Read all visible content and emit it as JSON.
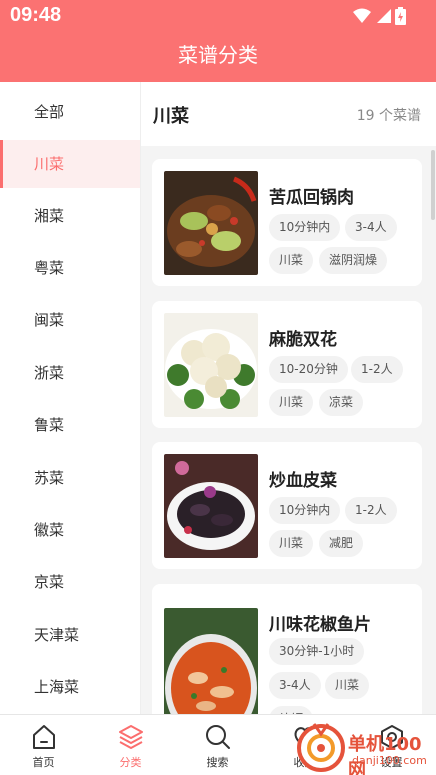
{
  "status_bar": {
    "time": "09:48"
  },
  "header": {
    "title": "菜谱分类"
  },
  "sidebar": {
    "items": [
      {
        "label": "全部"
      },
      {
        "label": "川菜",
        "active": true
      },
      {
        "label": "湘菜"
      },
      {
        "label": "粤菜"
      },
      {
        "label": "闽菜"
      },
      {
        "label": "浙菜"
      },
      {
        "label": "鲁菜"
      },
      {
        "label": "苏菜"
      },
      {
        "label": "徽菜"
      },
      {
        "label": "京菜"
      },
      {
        "label": "天津菜"
      },
      {
        "label": "上海菜"
      }
    ]
  },
  "content": {
    "category_title": "川菜",
    "recipe_count": "19 个菜谱",
    "recipes": [
      {
        "name": "苦瓜回锅肉",
        "tags": [
          "10分钟内",
          "3-4人",
          "川菜",
          "滋阴润燥"
        ]
      },
      {
        "name": "麻脆双花",
        "tags": [
          "10-20分钟",
          "1-2人",
          "川菜",
          "凉菜"
        ]
      },
      {
        "name": "炒血皮菜",
        "tags": [
          "10分钟内",
          "1-2人",
          "川菜",
          "减肥"
        ]
      },
      {
        "name": "川味花椒鱼片",
        "tags": [
          "30分钟-1小时",
          "3-4人",
          "川菜",
          "补钙"
        ]
      }
    ]
  },
  "tabbar": {
    "items": [
      {
        "label": "首页",
        "icon": "home-icon"
      },
      {
        "label": "分类",
        "icon": "layers-icon",
        "active": true
      },
      {
        "label": "搜索",
        "icon": "search-icon"
      },
      {
        "label": "收藏",
        "icon": "heart-icon"
      },
      {
        "label": "设置",
        "icon": "settings-icon"
      }
    ]
  },
  "watermark": {
    "line1": "单机100网",
    "line2": "danji100.com"
  },
  "colors": {
    "brand": "#fb7272",
    "accent": "#fb6e6e"
  }
}
